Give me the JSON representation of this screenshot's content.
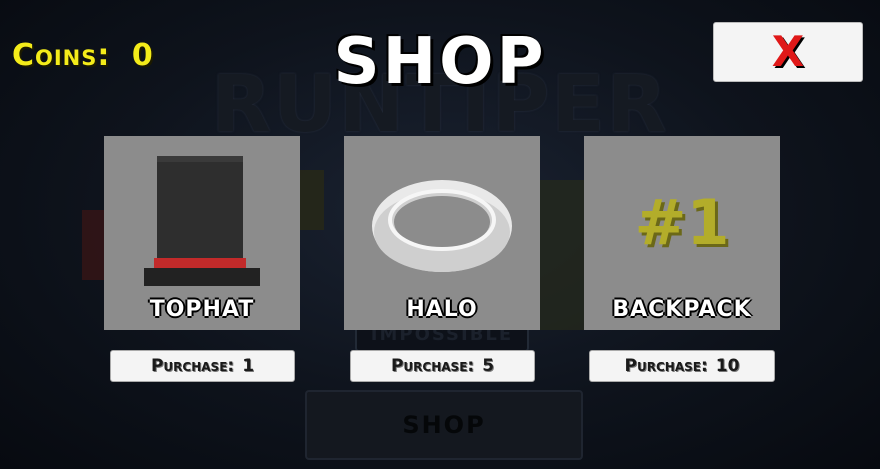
{
  "hud": {
    "coins_label": "Coins:",
    "coins_value": "0"
  },
  "header": {
    "title": "SHOP",
    "close_label": "X"
  },
  "background": {
    "game_title": "RUNTIPER",
    "impossible_label": "IMPOSSIBLE",
    "shop_button_label": "SHOP"
  },
  "items": [
    {
      "name": "TOPHAT",
      "purchase_label": "Purchase:",
      "price": "1",
      "icon": "tophat-icon"
    },
    {
      "name": "HALO",
      "purchase_label": "Purchase:",
      "price": "5",
      "icon": "halo-icon"
    },
    {
      "name": "BACKPACK",
      "purchase_label": "Purchase:",
      "price": "10",
      "icon": "number-one-icon",
      "icon_text": "#1"
    }
  ],
  "colors": {
    "coins": "#f4ec1a",
    "close": "#e01818",
    "card_bg": "#8a8a8a"
  }
}
